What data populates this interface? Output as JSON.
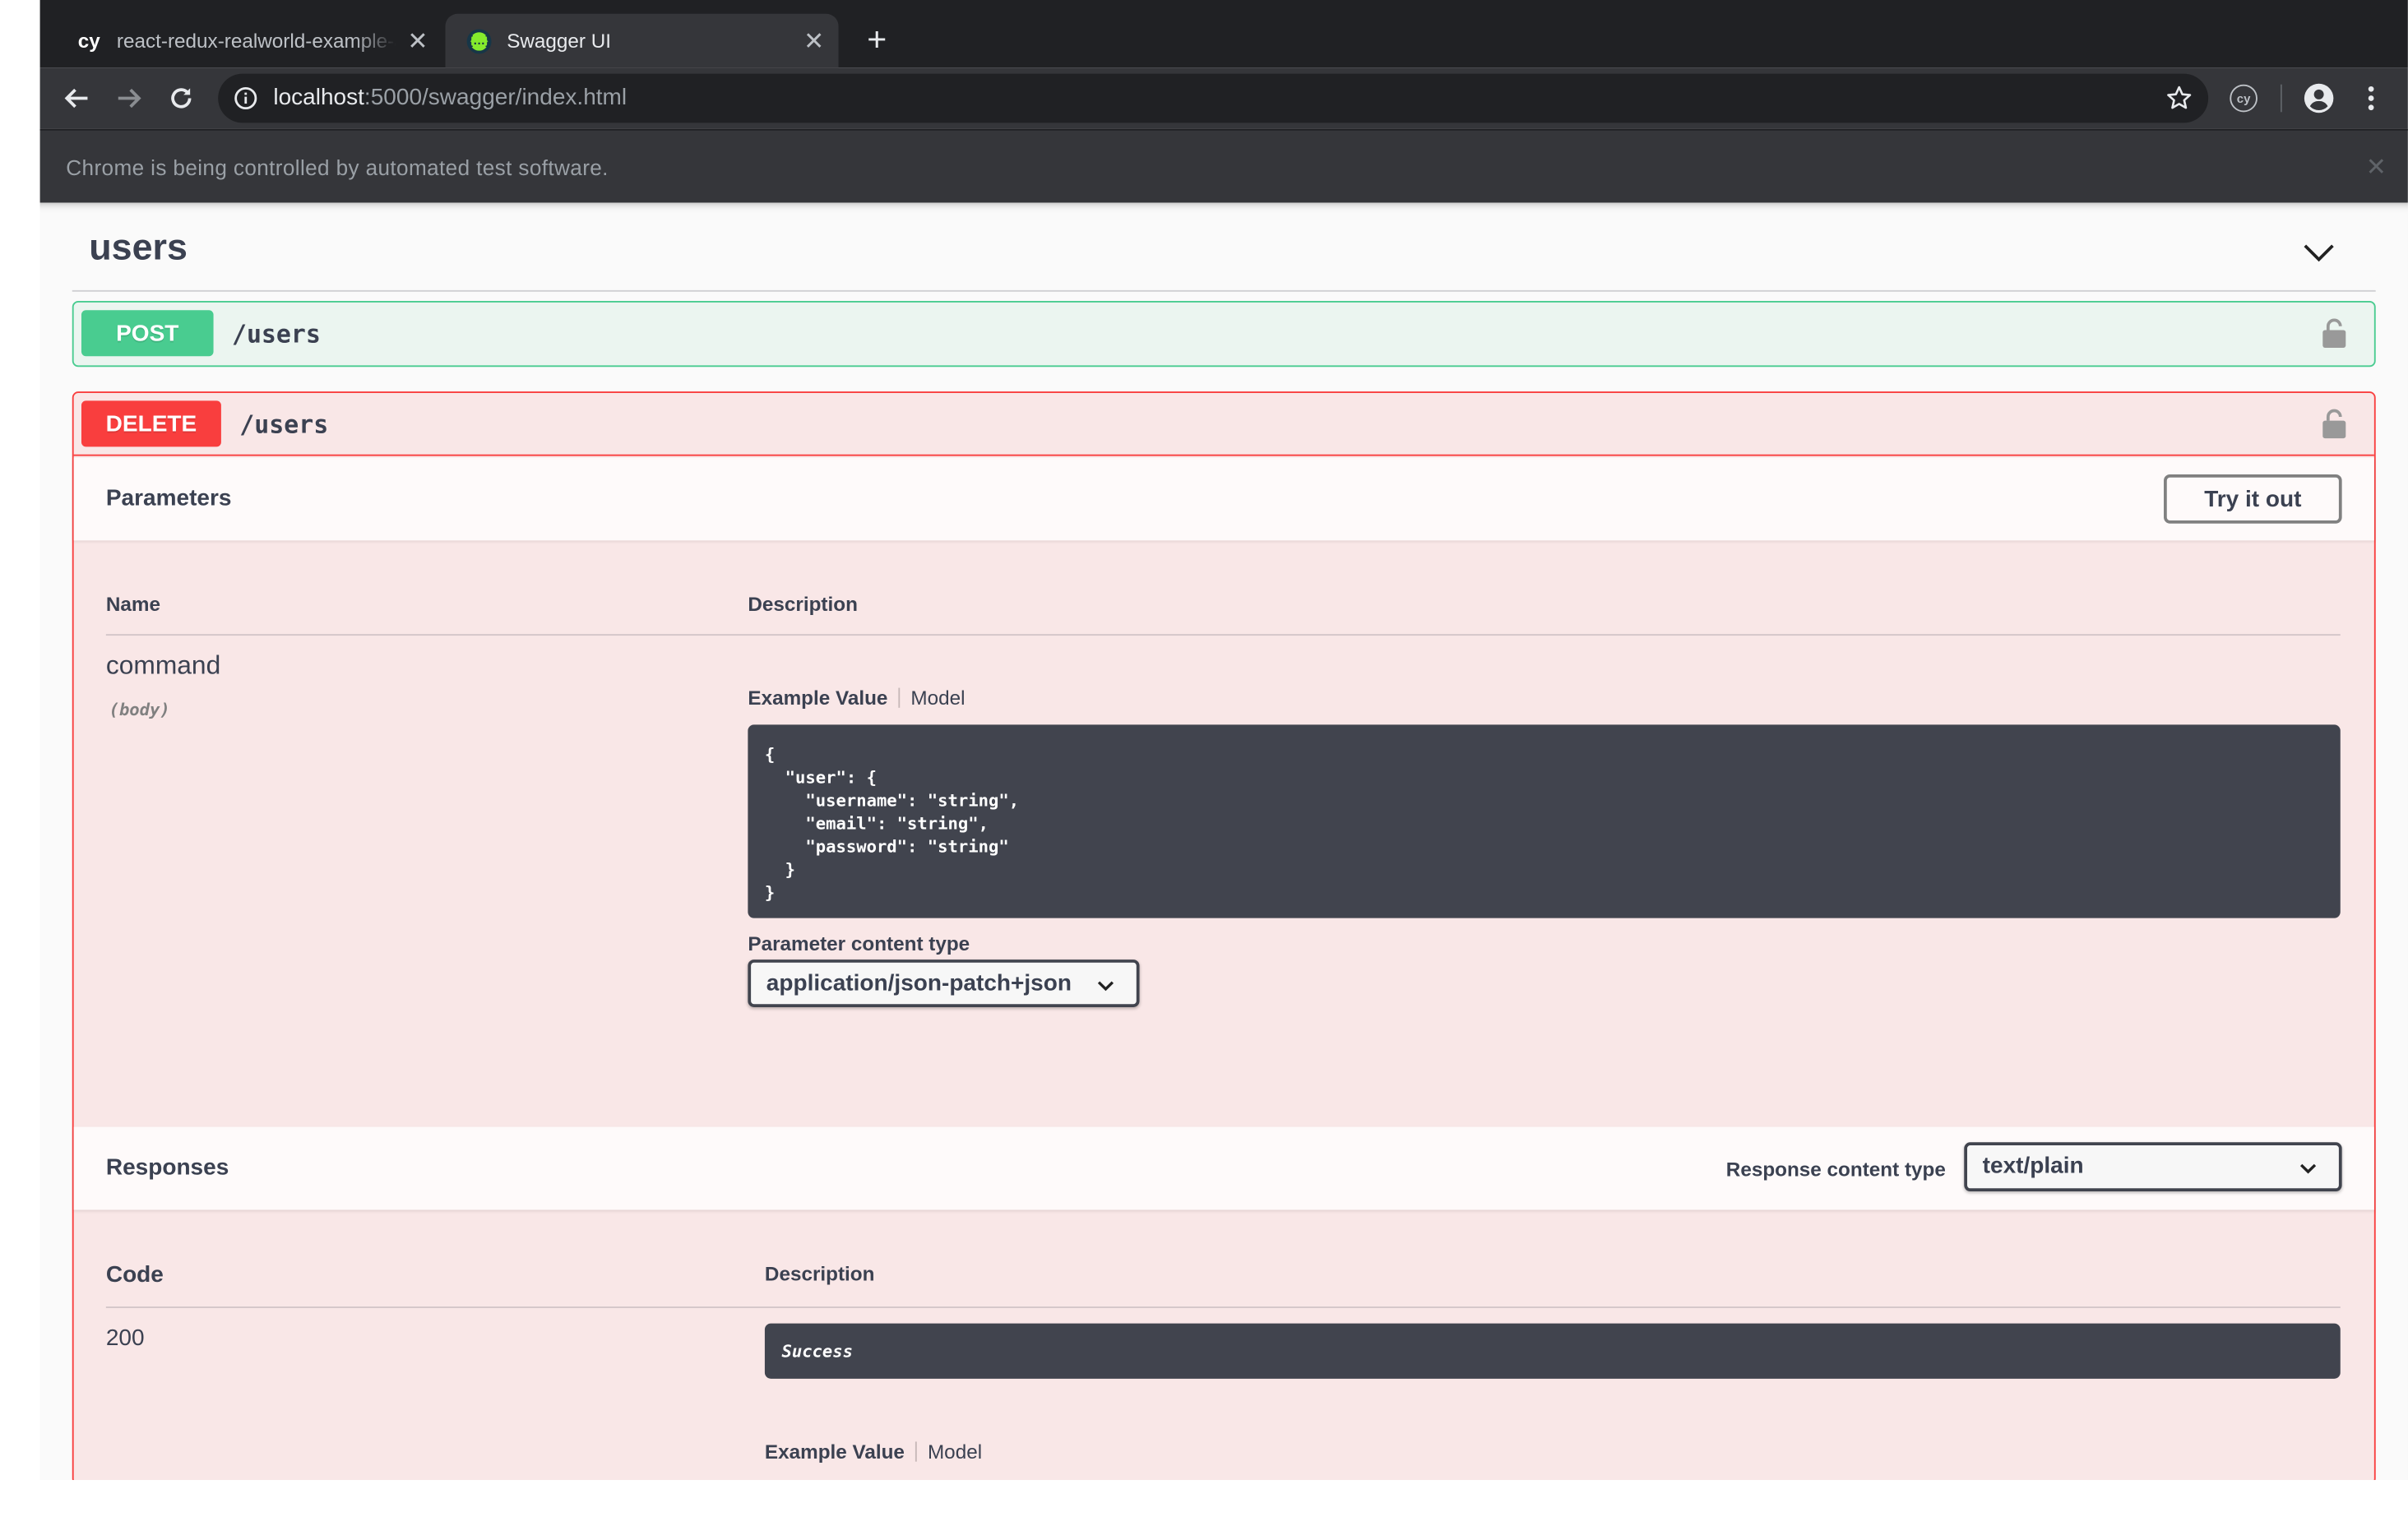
{
  "browser": {
    "tabs": [
      {
        "favicon": "cypress-icon",
        "favicon_text": "cy",
        "title": "react-redux-realworld-example-app",
        "active": false
      },
      {
        "favicon": "swagger-icon",
        "favicon_text": "{…}",
        "title": "Swagger UI",
        "active": true
      }
    ],
    "new_tab_label": "+",
    "url_host": "localhost",
    "url_rest": ":5000/swagger/index.html",
    "extension_label": "cy",
    "infobar_message": "Chrome is being controlled by automated test software.",
    "infobar_close": "✕"
  },
  "swagger": {
    "tag": "users",
    "operations": {
      "post": {
        "method": "POST",
        "path": "/users"
      },
      "delete": {
        "method": "DELETE",
        "path": "/users"
      }
    },
    "parameters": {
      "title": "Parameters",
      "try_it_out": "Try it out",
      "col_name": "Name",
      "col_description": "Description",
      "param_name": "command",
      "param_in": "(body)",
      "example_tab": "Example Value",
      "model_tab": "Model",
      "example_code": "{\n  \"user\": {\n    \"username\": \"string\",\n    \"email\": \"string\",\n    \"password\": \"string\"\n  }\n}",
      "content_type_label": "Parameter content type",
      "content_type_value": "application/json-patch+json"
    },
    "responses": {
      "title": "Responses",
      "content_type_label": "Response content type",
      "content_type_value": "text/plain",
      "col_code": "Code",
      "col_description": "Description",
      "code": "200",
      "description": "Success",
      "example_tab": "Example Value",
      "model_tab": "Model"
    }
  },
  "colors": {
    "post": "#49cc90",
    "delete": "#f93e3e",
    "text": "#3b4151",
    "code_bg": "#41444e"
  }
}
